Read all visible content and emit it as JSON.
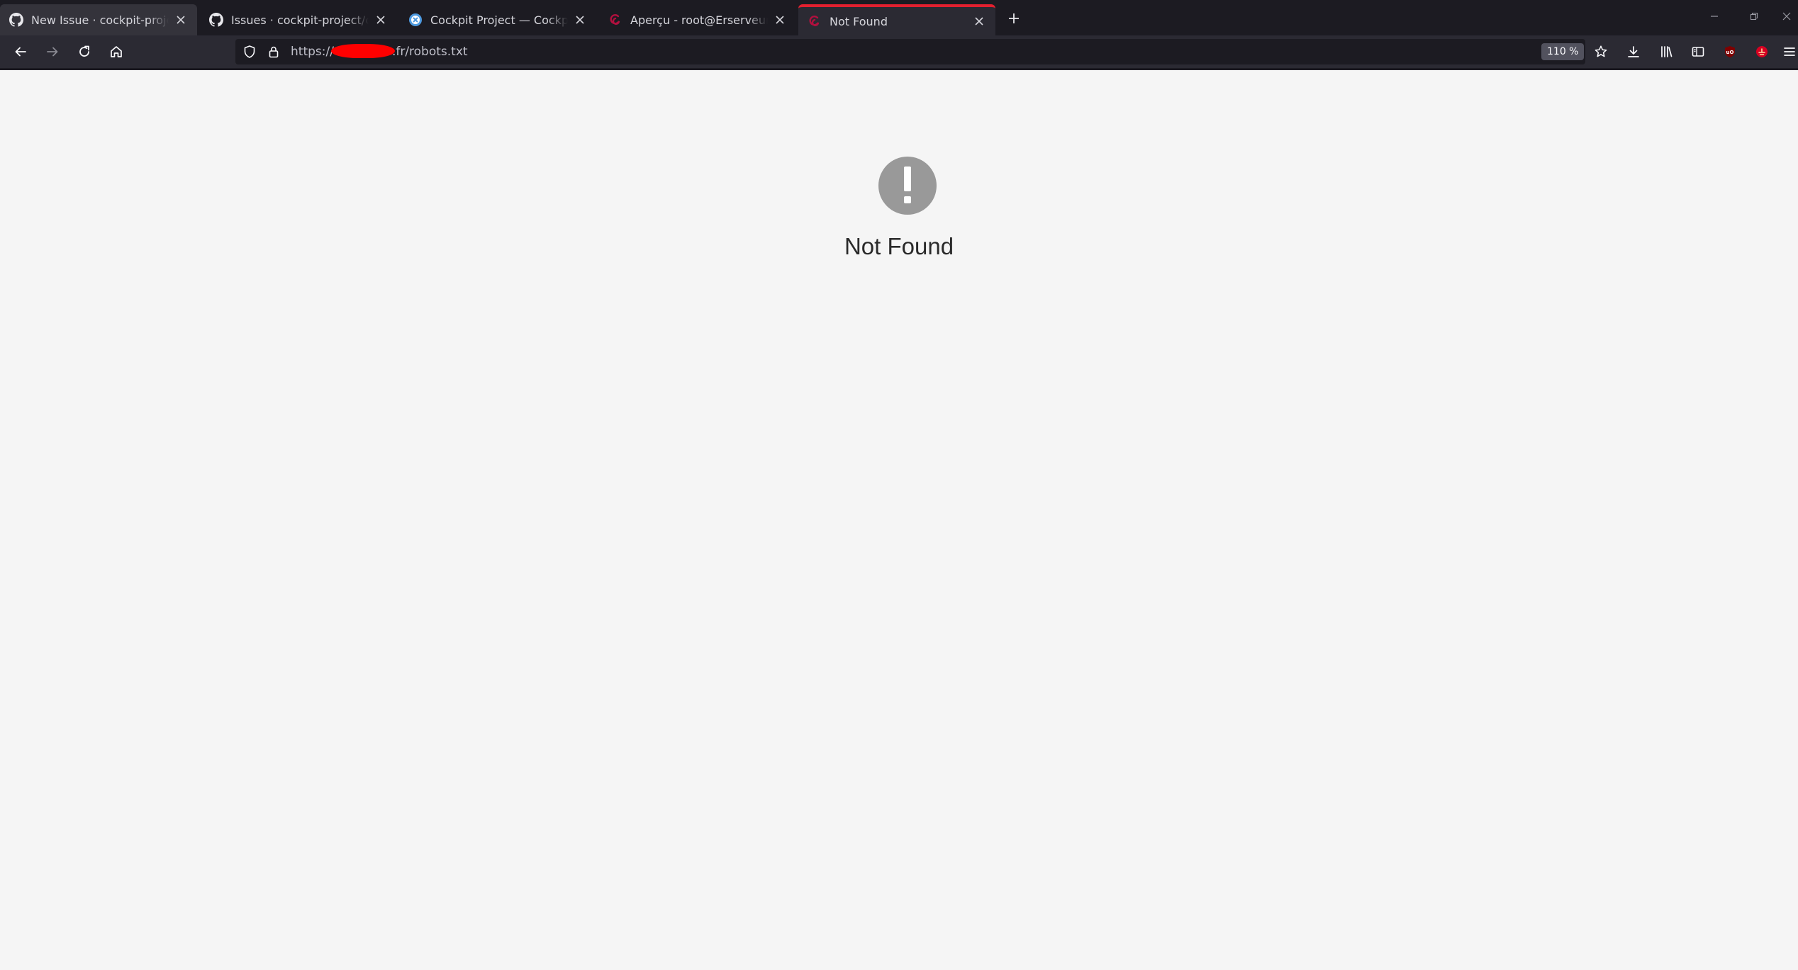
{
  "tabs": [
    {
      "label": "New Issue · cockpit-project/cockpit",
      "icon": "github-icon"
    },
    {
      "label": "Issues · cockpit-project/cockpit",
      "icon": "github-icon"
    },
    {
      "label": "Cockpit Project — Cockpit Project",
      "icon": "cockpit-icon"
    },
    {
      "label": "Aperçu - root@Erserveur",
      "icon": "debian-swirl-icon"
    },
    {
      "label": "Not Found",
      "icon": "debian-swirl-icon",
      "active": true
    }
  ],
  "urlbar": {
    "prefix": "https://",
    "suffix": ".fr/robots.txt",
    "redacted": true
  },
  "zoom": "110 %",
  "page": {
    "title": "Not Found",
    "icon": "exclamation-circle-icon"
  },
  "colors": {
    "accent": "#e2202f",
    "tabstrip": "#1c1b22",
    "toolbar": "#2b2a33",
    "page_bg": "#f5f5f5",
    "error_icon": "#999999",
    "redaction": "#ff0000"
  }
}
